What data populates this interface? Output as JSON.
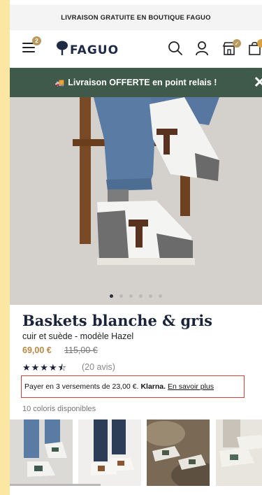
{
  "promo_top": "LIVRAISON GRATUITE EN BOUTIQUE FAGUO",
  "header": {
    "menu_badge": "2",
    "logo_text": "FAGUO",
    "icons": [
      "menu-icon",
      "tree-logo-icon",
      "search-icon",
      "account-icon",
      "store-icon",
      "cart-icon"
    ]
  },
  "shipping_banner": {
    "text": "Livraison OFFERTE en point relais !",
    "truck_emoji": "🚚",
    "close": "✕"
  },
  "gallery": {
    "dots": 6,
    "active_dot": 1
  },
  "product": {
    "title": "Baskets blanche & gris",
    "subtitle": "cuir et suède - modèle Hazel",
    "price": "69,00 €",
    "old_price": "115,00 €",
    "rating": 4.5,
    "stars": "★★★★⯪",
    "reviews": "(20 avis)"
  },
  "klarna": {
    "text": "Payer en 3 versements de 23,00 €.",
    "brand": "Klarna.",
    "link": "En savoir plus"
  },
  "colors_label": "10 coloris disponibles",
  "colors": {
    "accent": "#b89a5f",
    "banner": "#3f5a4a",
    "highlight_border": "#d43f3a"
  }
}
